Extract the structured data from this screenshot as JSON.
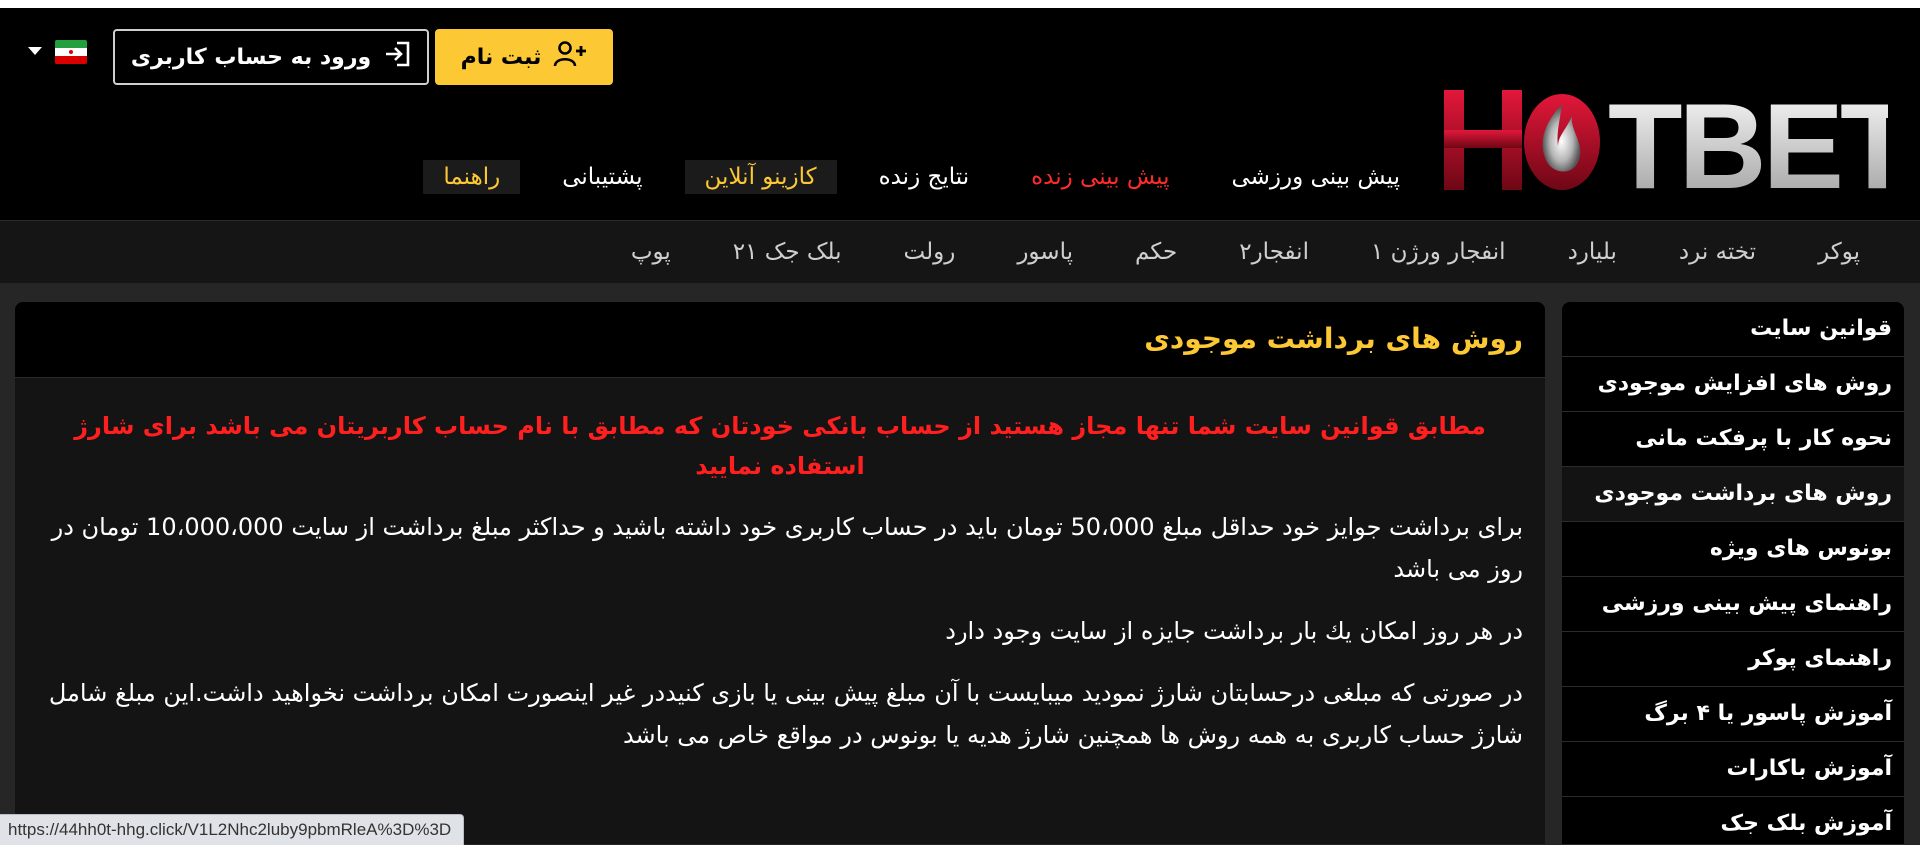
{
  "header": {
    "logo_text": "HOTBET",
    "register_label": "ثبت نام",
    "login_label": "ورود به حساب کاربری"
  },
  "main_nav": [
    {
      "label": "پیش بینی ورزشی",
      "color": "#ffffff",
      "boxed": false
    },
    {
      "label": "پیش بینی زنده",
      "color": "#ff2b2b",
      "boxed": false
    },
    {
      "label": "نتایج زنده",
      "color": "#ffffff",
      "boxed": false
    },
    {
      "label": "کازینو آنلاین",
      "color": "#fcc834",
      "boxed": true
    },
    {
      "label": "پشتیبانی",
      "color": "#ffffff",
      "boxed": false
    },
    {
      "label": "راهنما",
      "color": "#fcc834",
      "boxed": true
    }
  ],
  "sub_nav": [
    "پوکر",
    "تخته نرد",
    "بلیارد",
    "انفجار ورژن ۱",
    "انفجار۲",
    "حکم",
    "پاسور",
    "رولت",
    "بلک جک ۲۱",
    "پوپ"
  ],
  "sidebar": {
    "items": [
      {
        "label": "قوانین سایت",
        "active": false
      },
      {
        "label": "روش های افزایش موجودی",
        "active": false
      },
      {
        "label": "نحوه کار با پرفکت مانی",
        "active": false
      },
      {
        "label": "روش های برداشت موجودی",
        "active": true
      },
      {
        "label": "بونوس های ویژه",
        "active": false
      },
      {
        "label": "راهنمای پیش بینی ورزشی",
        "active": false
      },
      {
        "label": "راهنمای پوکر",
        "active": false
      },
      {
        "label": "آموزش پاسور یا ۴ برگ",
        "active": false
      },
      {
        "label": "آموزش باکارات",
        "active": false
      },
      {
        "label": "آموزش بلک جک",
        "active": false
      }
    ]
  },
  "content": {
    "title": "روش های برداشت موجودی",
    "warning": "مطابق قوانین سایت شما تنها مجاز هستید از حساب بانکی خودتان که مطابق با نام حساب کاربریتان می باشد برای شارژ استفاده نمایید",
    "paragraphs": [
      "برای برداشت جوایز خود حداقل مبلغ 50،000 تومان باید در حساب کاربری خود داشته باشید و حداکثر مبلغ برداشت از سایت 10،000،000 تومان در روز می باشد",
      "در هر روز امکان یك بار برداشت جایزه از سایت وجود دارد",
      "در صورتی که مبلغی درحسابتان شارژ نمودید میبایست با آن مبلغ پیش بینی یا بازی کنیددر غیر اینصورت امکان برداشت نخواهید داشت.این مبلغ شامل شارژ حساب کاربری به همه روش ها همچنین شارژ هدیه یا بونوس در مواقع خاص می باشد"
    ]
  },
  "statusbar": {
    "url": "https://44hh0t-hhg.click/V1L2Nhc2luby9pbmRleA%3D%3D"
  },
  "colors": {
    "accent_yellow": "#fcc834",
    "live_red": "#ff2b2b",
    "brand_red": "#c0102a"
  }
}
